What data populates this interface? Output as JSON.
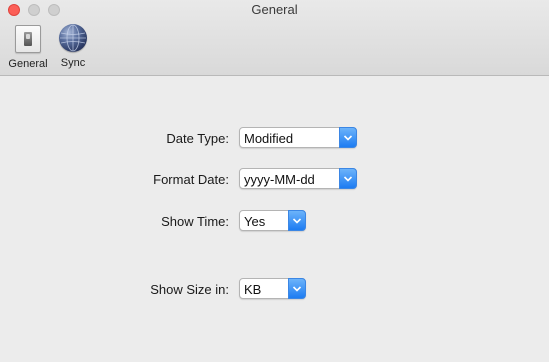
{
  "window": {
    "title": "General",
    "traffic_lights": {
      "close_color": "#fc5f57",
      "inactive_color": "#cfcfcf"
    }
  },
  "toolbar": {
    "items": [
      {
        "label": "General",
        "icon": "switch-icon",
        "selected": true
      },
      {
        "label": "Sync",
        "icon": "globe-icon",
        "selected": false
      }
    ]
  },
  "form": {
    "date_type": {
      "label": "Date Type:",
      "value": "Modified"
    },
    "format_date": {
      "label": "Format Date:",
      "value": "yyyy-MM-dd"
    },
    "show_time": {
      "label": "Show Time:",
      "value": "Yes"
    },
    "show_size": {
      "label": "Show Size in:",
      "value": "KB"
    }
  },
  "colors": {
    "accent": "#1d7cf2",
    "window_bg": "#ececec"
  }
}
